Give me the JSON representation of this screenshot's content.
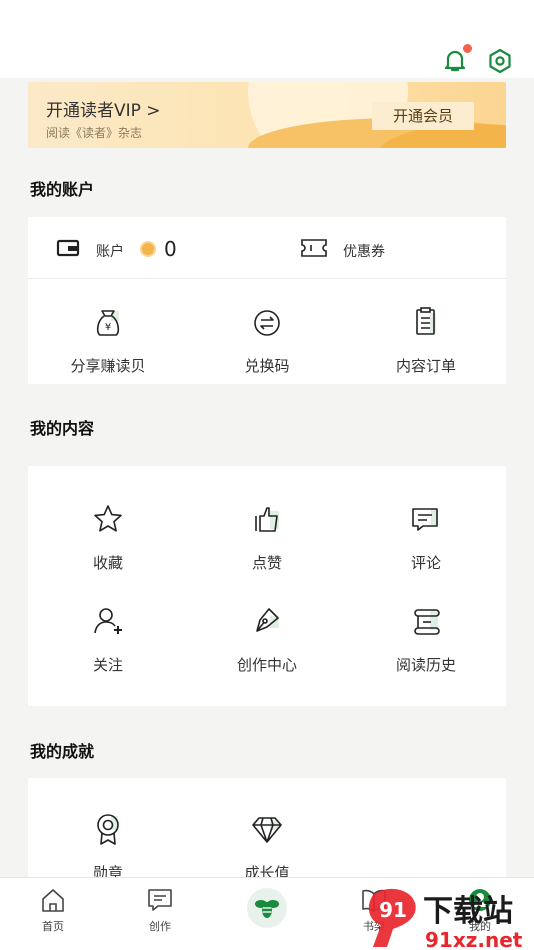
{
  "vip": {
    "title": "开通读者VIP >",
    "subtitle": "阅读《读者》杂志",
    "button": "开通会员"
  },
  "account": {
    "section_title": "我的账户",
    "account_label": "账户",
    "balance": "0",
    "coupon_label": "优惠券",
    "items": [
      {
        "label": "分享赚读贝",
        "icon": "money-bag-icon"
      },
      {
        "label": "兑换码",
        "icon": "exchange-icon"
      },
      {
        "label": "内容订单",
        "icon": "clipboard-icon"
      }
    ]
  },
  "content": {
    "section_title": "我的内容",
    "items": [
      {
        "label": "收藏",
        "icon": "star-icon"
      },
      {
        "label": "点赞",
        "icon": "thumbs-up-icon"
      },
      {
        "label": "评论",
        "icon": "comment-icon"
      },
      {
        "label": "关注",
        "icon": "add-user-icon"
      },
      {
        "label": "创作中心",
        "icon": "pen-icon"
      },
      {
        "label": "阅读历史",
        "icon": "scroll-icon"
      }
    ]
  },
  "achievements": {
    "section_title": "我的成就",
    "items": [
      {
        "label": "勋章",
        "icon": "medal-icon"
      },
      {
        "label": "成长值",
        "icon": "diamond-icon"
      }
    ]
  },
  "tabbar": {
    "items": [
      {
        "label": "首页",
        "icon": "home-icon"
      },
      {
        "label": "创作",
        "icon": "create-icon"
      },
      {
        "label": "",
        "icon": "bee-icon"
      },
      {
        "label": "书架",
        "icon": "bookshelf-icon"
      },
      {
        "label": "我的",
        "icon": "profile-icon"
      }
    ]
  },
  "colors": {
    "accent": "#1a8a3c",
    "notification_dot": "#f2624d",
    "vip_gold": "#f7c266"
  },
  "watermark": {
    "text": "下载站",
    "site": "91xz.net"
  }
}
